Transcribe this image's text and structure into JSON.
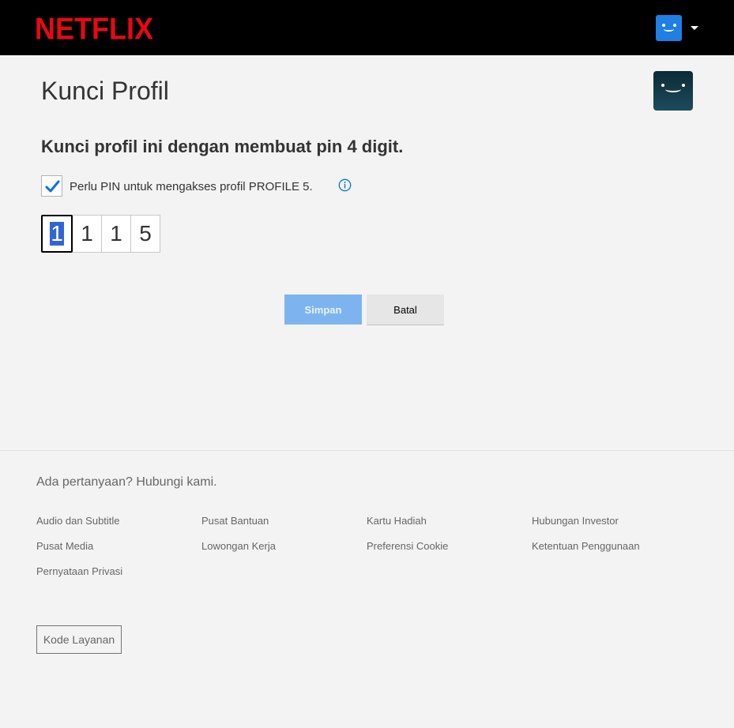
{
  "header": {
    "logo_text": "NETFLIX",
    "brand_color": "#e50914",
    "avatar_color": "#1f7fe3"
  },
  "main": {
    "title": "Kunci Profil",
    "subtitle": "Kunci profil ini dengan membuat pin 4 digit.",
    "checkbox": {
      "checked": true,
      "label": "Perlu PIN untuk mengakses profil PROFILE 5."
    },
    "pin": [
      "1",
      "1",
      "1",
      "5"
    ],
    "save_label": "Simpan",
    "cancel_label": "Batal"
  },
  "footer": {
    "question": "Ada pertanyaan? Hubungi kami.",
    "links": [
      "Audio dan Subtitle",
      "Pusat Bantuan",
      "Kartu Hadiah",
      "Hubungan Investor",
      "Pusat Media",
      "Lowongan Kerja",
      "Preferensi Cookie",
      "Ketentuan Penggunaan",
      "Pernyataan Privasi"
    ],
    "service_code_label": "Kode Layanan"
  }
}
